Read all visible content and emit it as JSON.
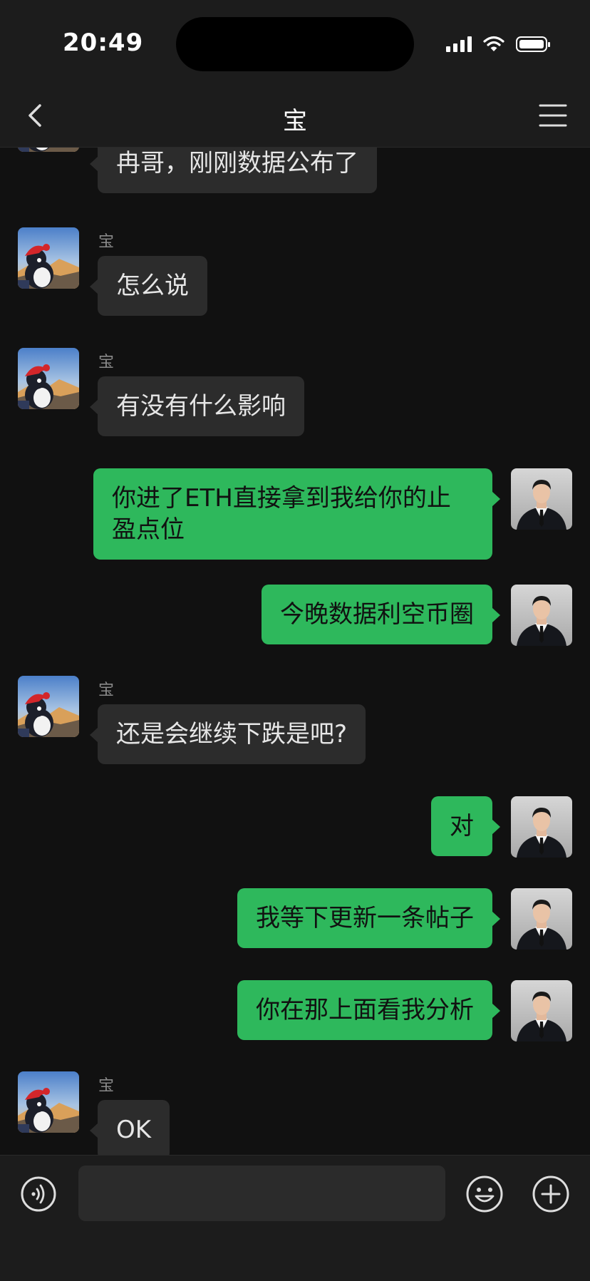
{
  "status_bar": {
    "time": "20:49"
  },
  "header": {
    "title": "宝"
  },
  "messages": [
    {
      "from": "contact",
      "sender": "宝",
      "text": "冉哥，刚刚数据公布了"
    },
    {
      "from": "contact",
      "sender": "宝",
      "text": "怎么说"
    },
    {
      "from": "contact",
      "sender": "宝",
      "text": "有没有什么影响"
    },
    {
      "from": "me",
      "text": "你进了ETH直接拿到我给你的止\n盈点位"
    },
    {
      "from": "me",
      "text": "今晚数据利空币圈"
    },
    {
      "from": "contact",
      "sender": "宝",
      "text": "还是会继续下跌是吧?"
    },
    {
      "from": "me",
      "text": "对"
    },
    {
      "from": "me",
      "text": "我等下更新一条帖子"
    },
    {
      "from": "me",
      "text": "你在那上面看我分析"
    },
    {
      "from": "contact",
      "sender": "宝",
      "text": "OK"
    }
  ],
  "input": {
    "value": "",
    "placeholder": ""
  },
  "icons": {
    "back": "chevron-left-icon",
    "menu": "hamburger-menu-icon",
    "voice": "voice-icon",
    "emoji": "emoji-icon",
    "plus": "plus-icon"
  },
  "colors": {
    "outgoing_bubble": "#2eb85c",
    "incoming_bubble": "#2c2c2c",
    "background": "#111111",
    "bars": "#1c1c1c"
  }
}
